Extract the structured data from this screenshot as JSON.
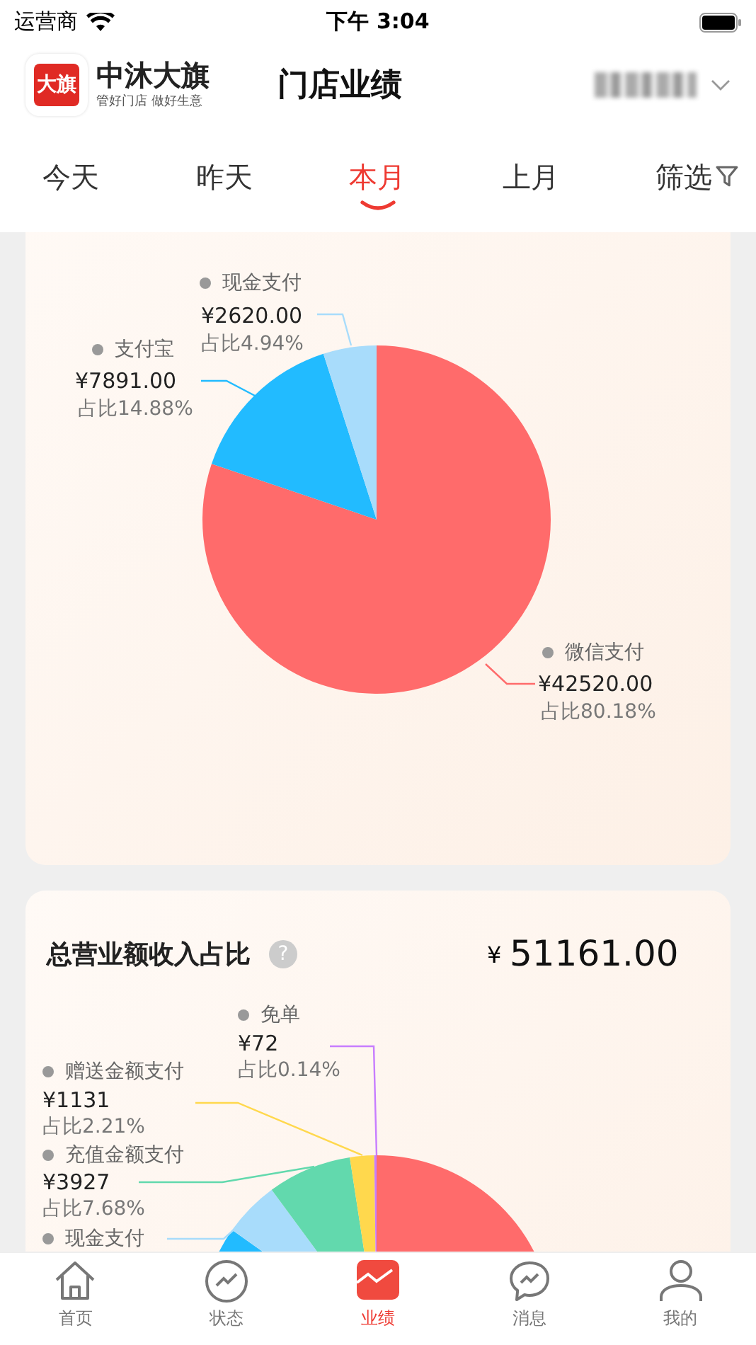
{
  "status_bar": {
    "carrier": "运营商",
    "time": "下午 3:04"
  },
  "header": {
    "logo_badge": "大旗",
    "brand_name": "中沐大旗",
    "brand_slogan": "管好门店 做好生意",
    "title": "门店业绩"
  },
  "period_tabs": [
    {
      "label": "今天",
      "selected": false
    },
    {
      "label": "昨天",
      "selected": false
    },
    {
      "label": "本月",
      "selected": true
    },
    {
      "label": "上月",
      "selected": false
    }
  ],
  "filter_button": {
    "label": "筛选"
  },
  "payment_card": {
    "labels": [
      {
        "name": "微信支付",
        "amount": "¥42520.00",
        "share": "占比80.18%",
        "color": "#ff6b6b"
      },
      {
        "name": "支付宝",
        "amount": "¥7891.00",
        "share": "占比14.88%",
        "color": "#22bbff"
      },
      {
        "name": "现金支付",
        "amount": "¥2620.00",
        "share": "占比4.94%",
        "color": "#a8dcfb"
      }
    ]
  },
  "revenue_card": {
    "title": "总营业额收入占比",
    "help_icon": "?",
    "currency": "¥",
    "total": "51161.00",
    "labels": [
      {
        "name": "免单",
        "amount": "¥72",
        "share": "占比0.14%",
        "color": "#c77dff"
      },
      {
        "name": "赠送金额支付",
        "amount": "¥1131",
        "share": "占比2.21%",
        "color": "#ffd84d"
      },
      {
        "name": "充值金额支付",
        "amount": "¥3927",
        "share": "占比7.68%",
        "color": "#62d9ad"
      },
      {
        "name": "现金支付",
        "color": "#a8dcfb"
      }
    ]
  },
  "tab_bar": [
    {
      "label": "首页",
      "selected": false
    },
    {
      "label": "状态",
      "selected": false
    },
    {
      "label": "业绩",
      "selected": true
    },
    {
      "label": "消息",
      "selected": false
    },
    {
      "label": "我的",
      "selected": false
    }
  ]
}
